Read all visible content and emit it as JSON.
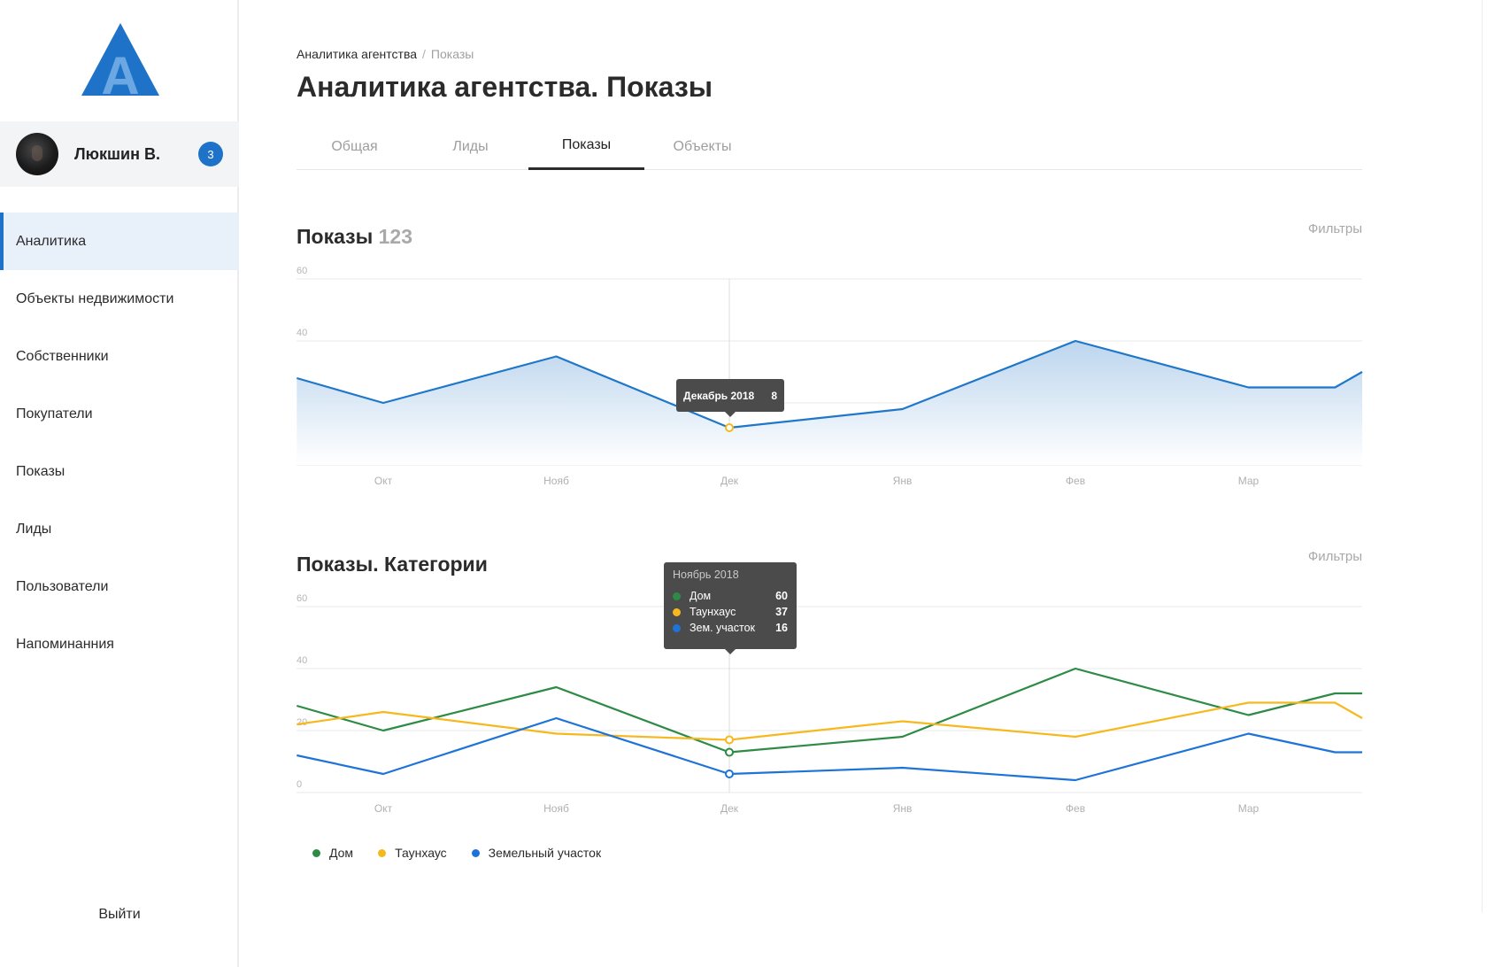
{
  "app": {
    "logo_letter": "A"
  },
  "user": {
    "name": "Люкшин В.",
    "badge": "3"
  },
  "sidebar": {
    "items": [
      {
        "label": "Аналитика",
        "active": true
      },
      {
        "label": "Объекты недвижимости",
        "active": false
      },
      {
        "label": "Собственники",
        "active": false
      },
      {
        "label": "Покупатели",
        "active": false
      },
      {
        "label": "Показы",
        "active": false
      },
      {
        "label": "Лиды",
        "active": false
      },
      {
        "label": "Пользователи",
        "active": false
      },
      {
        "label": "Напоминанния",
        "active": false
      }
    ],
    "logout_label": "Выйти"
  },
  "header": {
    "breadcrumb": {
      "parent": "Аналитика агентства",
      "separator": "/",
      "current": "Показы"
    },
    "title": "Аналитика агентства. Показы"
  },
  "tabs": [
    {
      "label": "Общая",
      "active": false
    },
    {
      "label": "Лиды",
      "active": false
    },
    {
      "label": "Показы",
      "active": true
    },
    {
      "label": "Объекты",
      "active": false
    }
  ],
  "section1": {
    "title": "Показы",
    "count": "123",
    "filters_label": "Фильтры"
  },
  "section2": {
    "title": "Показы. Категории",
    "filters_label": "Фильтры"
  },
  "tooltip1": {
    "label": "Декабрь 2018",
    "value": "8"
  },
  "tooltip2": {
    "title": "Ноябрь 2018",
    "rows": [
      {
        "label": "Дом",
        "value": "60",
        "color": "#2e8b45"
      },
      {
        "label": "Таунхаус",
        "value": "37",
        "color": "#f5b91e"
      },
      {
        "label": "Зем. участок",
        "value": "16",
        "color": "#1e73d8"
      }
    ]
  },
  "legend": [
    {
      "label": "Дом",
      "color": "#2e8b45"
    },
    {
      "label": "Таунхаус",
      "color": "#f5b91e"
    },
    {
      "label": "Земельный участок",
      "color": "#1e73d8"
    }
  ],
  "colors": {
    "accent": "#1e73c8",
    "line": "#1f77c9"
  },
  "chart_data": [
    {
      "type": "area",
      "title": "Показы",
      "x_labels": [
        "Окт",
        "Нояб",
        "Дек",
        "Янв",
        "Фев",
        "Мар"
      ],
      "x": [
        -0.5,
        0,
        1,
        2,
        3,
        4,
        5,
        5.5,
        5.7
      ],
      "values": [
        28,
        20,
        35,
        12,
        18,
        40,
        25,
        25,
        30
      ],
      "ylim": [
        0,
        60
      ],
      "yticks": [
        0,
        20,
        40,
        60
      ],
      "grid": true,
      "highlight_index": 3
    },
    {
      "type": "line",
      "title": "Показы. Категории",
      "x_labels": [
        "Окт",
        "Нояб",
        "Дек",
        "Янв",
        "Фев",
        "Мар"
      ],
      "x": [
        -0.5,
        0,
        1,
        2,
        3,
        4,
        5,
        5.5,
        5.7
      ],
      "ylim": [
        0,
        60
      ],
      "yticks": [
        0,
        20,
        40,
        60
      ],
      "grid": true,
      "highlight_index": 3,
      "series": [
        {
          "name": "Дом",
          "color": "#2e8b45",
          "values": [
            28,
            20,
            34,
            13,
            18,
            40,
            25,
            32,
            32
          ]
        },
        {
          "name": "Таунхаус",
          "color": "#f5b91e",
          "values": [
            22,
            26,
            19,
            17,
            23,
            18,
            29,
            29,
            24
          ]
        },
        {
          "name": "Земельный участок",
          "color": "#1e73d8",
          "values": [
            12,
            6,
            24,
            6,
            8,
            4,
            19,
            13,
            13
          ]
        }
      ]
    }
  ]
}
